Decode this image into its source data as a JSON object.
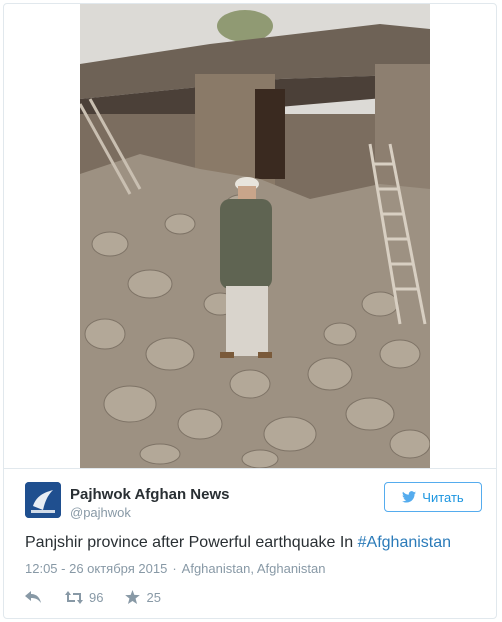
{
  "tweet": {
    "author_name": "Pajhwok Afghan News",
    "author_handle": "@pajhwok",
    "follow_label": "Читать",
    "text_main": "Panjshir province after Powerful earthquake In ",
    "hashtag": "#Afghanistan",
    "time": "12:05 - 26 октября 2015",
    "separator": "·",
    "location": "Afghanistan, Afghanistan",
    "retweet_count": "96",
    "like_count": "25"
  },
  "icons": {
    "reply": "reply-icon",
    "retweet": "retweet-icon",
    "like": "star-icon",
    "follow": "twitter-bird-icon",
    "avatar": "pajhwok-logo"
  },
  "colors": {
    "link": "#2b7bb9",
    "follow_border": "#55acee",
    "muted": "#8899a6",
    "text": "#292f33"
  }
}
